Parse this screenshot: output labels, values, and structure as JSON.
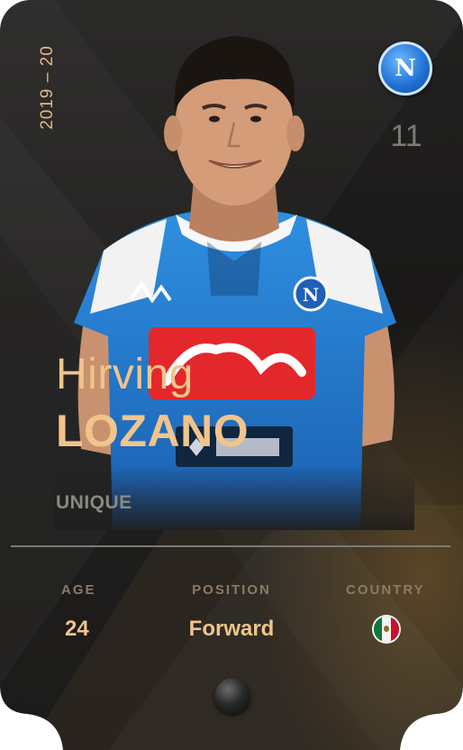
{
  "card": {
    "season": "2019 – 20",
    "club_badge": {
      "letter": "N",
      "icon": "napoli-badge-icon",
      "color": "#1f6fd1"
    },
    "shirt_number": "11",
    "player": {
      "first_name": "Hirving",
      "last_name": "LOZANO"
    },
    "rarity": "UNIQUE",
    "stats": {
      "age": {
        "label": "AGE",
        "value": "24"
      },
      "position": {
        "label": "POSITION",
        "value": "Forward"
      },
      "country": {
        "label": "COUNTRY",
        "flag_icon": "mexico-flag-icon",
        "colors": [
          "#0b7a3b",
          "#f4f4f4",
          "#c8102e"
        ]
      }
    },
    "accent_color": "#f1c48c"
  }
}
